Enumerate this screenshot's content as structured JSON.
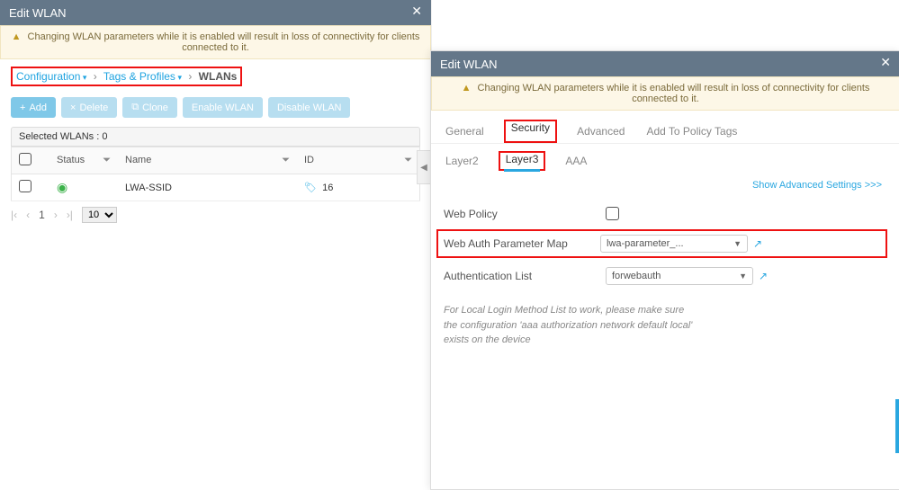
{
  "left": {
    "title": "Edit WLAN",
    "alert": "Changing WLAN parameters while it is enabled will result in loss of connectivity for clients connected to it.",
    "breadcrumb": {
      "c1": "Configuration",
      "c2": "Tags & Profiles",
      "current": "WLANs"
    },
    "buttons": {
      "add": "Add",
      "delete": "Delete",
      "clone": "Clone",
      "enable": "Enable WLAN",
      "disable": "Disable WLAN"
    },
    "selected": "Selected WLANs : 0",
    "cols": {
      "status": "Status",
      "name": "Name",
      "id": "ID"
    },
    "row": {
      "name": "LWA-SSID",
      "id": "16"
    },
    "pager": {
      "page": "1",
      "size": "10"
    }
  },
  "right": {
    "title": "Edit WLAN",
    "alert": "Changing WLAN parameters while it is enabled will result in loss of connectivity for clients connected to it.",
    "tabs": {
      "general": "General",
      "security": "Security",
      "advanced": "Advanced",
      "policy": "Add To Policy Tags"
    },
    "subtabs": {
      "l2": "Layer2",
      "l3": "Layer3",
      "aaa": "AAA"
    },
    "advlink": "Show Advanced Settings >>>",
    "form": {
      "webpolicy_lbl": "Web Policy",
      "map_lbl": "Web Auth Parameter Map",
      "map_val": "lwa-parameter_...",
      "authlist_lbl": "Authentication List",
      "authlist_val": "forwebauth"
    },
    "note1": "For Local Login Method List to work, please make sure",
    "note2": "the configuration 'aaa authorization network default local'",
    "note3": "exists on the device"
  }
}
